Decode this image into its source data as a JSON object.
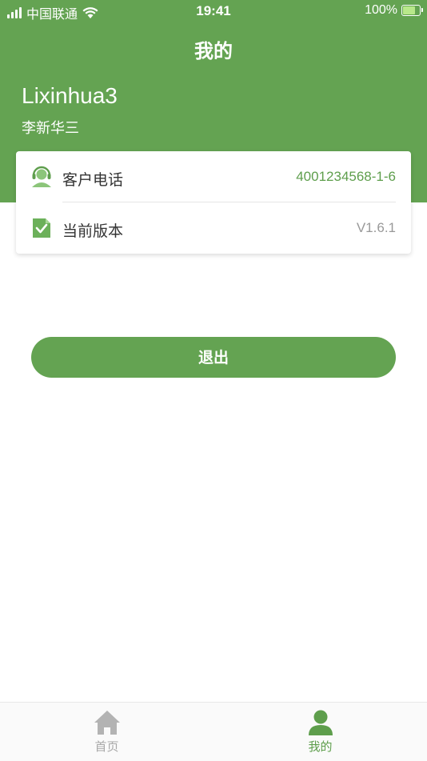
{
  "status_bar": {
    "carrier": "中国联通",
    "time": "19:41",
    "battery": "100%"
  },
  "header": {
    "title": "我的",
    "user_name": "Lixinhua3",
    "user_subname": "李新华三"
  },
  "info_card": {
    "items": [
      {
        "icon": "headset-icon",
        "label": "客户电话",
        "value": "4001234568-1-6"
      },
      {
        "icon": "document-check-icon",
        "label": "当前版本",
        "value": "V1.6.1"
      }
    ]
  },
  "logout_label": "退出",
  "tabbar": {
    "tabs": [
      {
        "icon": "home-icon",
        "label": "首页",
        "active": false
      },
      {
        "icon": "person-icon",
        "label": "我的",
        "active": true
      }
    ]
  },
  "colors": {
    "brand": "#64a352",
    "accent_text": "#5e9e4c",
    "inactive": "#a8a8a8"
  }
}
